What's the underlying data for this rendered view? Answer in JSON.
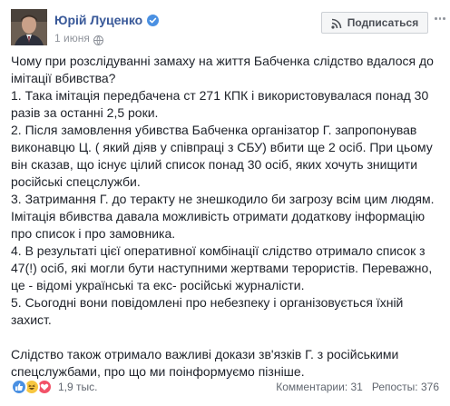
{
  "author": {
    "name": "Юрій Луценко",
    "verified_icon": "verified-badge-icon",
    "date": "1 июня",
    "privacy_icon": "globe-icon"
  },
  "actions": {
    "subscribe_label": "Подписаться",
    "subscribe_icon": "rss-icon",
    "more_icon": "more-horizontal-icon"
  },
  "post": {
    "paragraphs": [
      "Чому при розслідуванні замаху на життя Бабченка слідство вдалося до імітації вбивства?",
      "1. Така імітація передбачена ст 271 КПК і використовувалася понад 30 разів за останні 2,5 роки.",
      "2. Після замовлення убивства Бабченка організатор Г. запропонував виконавцю Ц. ( який діяв у співпраці з СБУ) вбити ще 2 осіб. При цьому він сказав, що існує цілий список понад 30 осіб, яких хочуть знищити російські спецслужби.",
      "3. Затримання Г. до теракту не знешкодило би загрозу всім цим людям. Імітація вбивства давала можливість отримати додаткову інформацію про список і про замовника.",
      "4. В результаті цієї оперативної комбінації слідство отримало список з 47(!) осіб, які могли бути наступними жертвами терористів. Переважно, це - відомі українські та екс- російські журналісти.",
      "5. Сьогодні вони повідомлені про небезпеку і організовується їхній захист.",
      "Слідство також отримало важливі докази зв'язків Г. з російськими спецслужбами, про що ми поінформуємо пізніше."
    ]
  },
  "footer": {
    "reaction_icons": [
      "like-icon",
      "haha-icon",
      "love-icon"
    ],
    "reaction_count": "1,9 тыс.",
    "comments": "Комментарии: 31",
    "shares": "Репосты: 376"
  },
  "colors": {
    "link": "#385898",
    "text": "#1d2129",
    "meta": "#90949c",
    "like": "#4a90e2",
    "haha": "#f7c640",
    "love": "#f25268"
  }
}
